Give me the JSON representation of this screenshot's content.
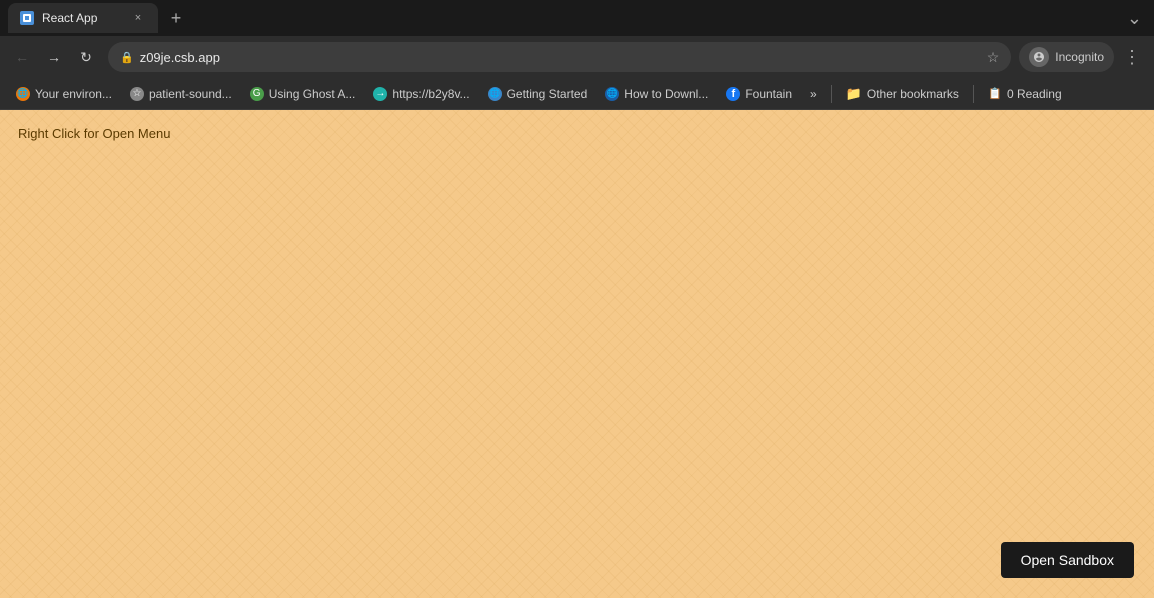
{
  "browser": {
    "tab": {
      "icon_label": "tab-icon",
      "label": "React App",
      "close_label": "×"
    },
    "new_tab_label": "+",
    "tab_bar_dropdown": "⌄",
    "nav": {
      "back_label": "←",
      "forward_label": "→",
      "reload_label": "↻",
      "url": "z09je.csb.app",
      "lock_label": "🔒",
      "star_label": "☆",
      "incognito_label": "Incognito",
      "menu_label": "⋮"
    },
    "bookmarks": [
      {
        "id": "bm1",
        "icon_color": "bm-orange",
        "icon_text": "🌐",
        "label": "Your environ..."
      },
      {
        "id": "bm2",
        "icon_color": "bm-gray",
        "icon_text": "☆",
        "label": "patient-sound..."
      },
      {
        "id": "bm3",
        "icon_color": "bm-green",
        "icon_text": "G",
        "label": "Using Ghost A..."
      },
      {
        "id": "bm4",
        "icon_color": "bm-teal",
        "icon_text": "→",
        "label": "https://b2y8v..."
      },
      {
        "id": "bm5",
        "icon_color": "bm-blue-circle",
        "icon_text": "🌐",
        "label": "Getting Started"
      },
      {
        "id": "bm6",
        "icon_color": "bm-blue-dark",
        "icon_text": "🌐",
        "label": "How to Downl..."
      },
      {
        "id": "bm7",
        "icon_color": "bm-fb-blue",
        "icon_text": "f",
        "label": "Fountain"
      }
    ],
    "bookmarks_more_label": "»",
    "other_bookmarks_label": "Other bookmarks",
    "reading_list_label": "0 Reading",
    "reading_list_icon": "📖"
  },
  "page": {
    "right_click_hint": "Right Click for Open Menu",
    "open_sandbox_label": "Open Sandbox",
    "background_color": "#f5c98a"
  }
}
